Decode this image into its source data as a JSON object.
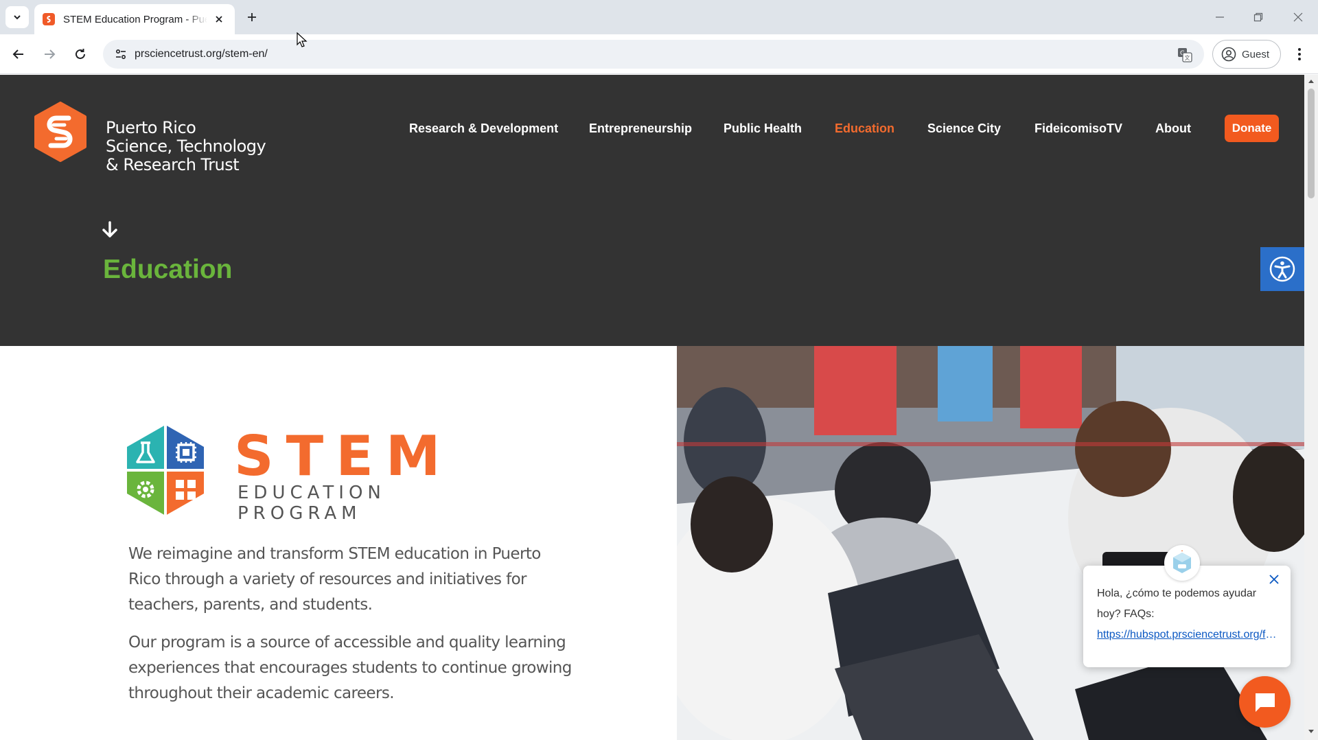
{
  "browser": {
    "tab_title": "STEM Education Program - Puerto Rico Science, Technology & Research Trust",
    "url": "prsciencetrust.org/stem-en/",
    "profile_label": "Guest"
  },
  "site": {
    "logo_lines": [
      "Puerto Rico",
      "Science, Technology",
      "& Research Trust"
    ],
    "nav": [
      {
        "label": "Research & Development",
        "active": false
      },
      {
        "label": "Entrepreneurship",
        "active": false
      },
      {
        "label": "Public Health",
        "active": false
      },
      {
        "label": "Education",
        "active": true
      },
      {
        "label": "Science City",
        "active": false
      },
      {
        "label": "FideicomisoTV",
        "active": false
      },
      {
        "label": "About",
        "active": false
      }
    ],
    "donate_label": "Donate"
  },
  "hero": {
    "title": "Education"
  },
  "stem_logo": {
    "word": "STEM",
    "subtitle": "EDUCATION PROGRAM"
  },
  "content": {
    "paragraphs": [
      "We reimagine and transform STEM education in Puerto Rico through a variety of resources and initiatives for teachers, parents, and students.",
      "Our program is a source of accessible and quality learning experiences that encourages students to continue growing throughout their academic careers."
    ]
  },
  "chat": {
    "message": "Hola, ¿cómo te podemos ayudar hoy? FAQs:",
    "link": "https://hubspot.prsciencetrust.org/faqs"
  },
  "colors": {
    "brand_orange": "#f36b2e",
    "hero_bg": "#333333",
    "title_green": "#6ab53c",
    "a11y_blue": "#2b6fc9"
  },
  "icons": [
    "tab-list-icon",
    "favicon-icon",
    "close-icon",
    "plus-icon",
    "minimize-icon",
    "restore-icon",
    "back-icon",
    "forward-icon",
    "reload-icon",
    "site-info-icon",
    "translate-icon",
    "profile-icon",
    "more-icon",
    "arrow-down-icon",
    "accessibility-icon",
    "chat-icon"
  ]
}
